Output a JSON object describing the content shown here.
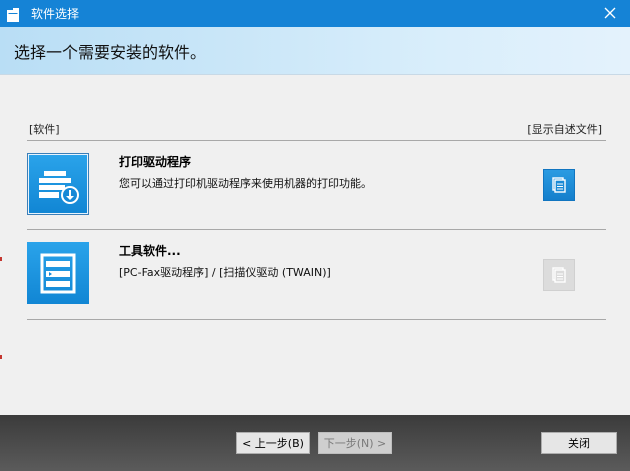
{
  "window": {
    "title": "软件选择",
    "close_icon": "close-icon"
  },
  "header": {
    "heading": "选择一个需要安装的软件。"
  },
  "table": {
    "col_software": "[软件]",
    "col_readme": "[显示自述文件]"
  },
  "items": [
    {
      "title": "打印驱动程序",
      "description": "您可以通过打印机驱动程序来使用机器的打印功能。",
      "icon": "printer-download-icon",
      "selected": true,
      "readme_enabled": true
    },
    {
      "title": "工具软件...",
      "description": "[PC-Fax驱动程序] / [扫描仪驱动 (TWAIN)]",
      "icon": "tools-icon",
      "selected": false,
      "readme_enabled": false
    }
  ],
  "footer": {
    "back_label": "< 上一步(B)",
    "next_label": "下一步(N) >",
    "close_label": "关闭"
  },
  "colors": {
    "titlebar": "#1583d6",
    "accent": "#1a8fdc",
    "footer": "#4a4a4a"
  }
}
